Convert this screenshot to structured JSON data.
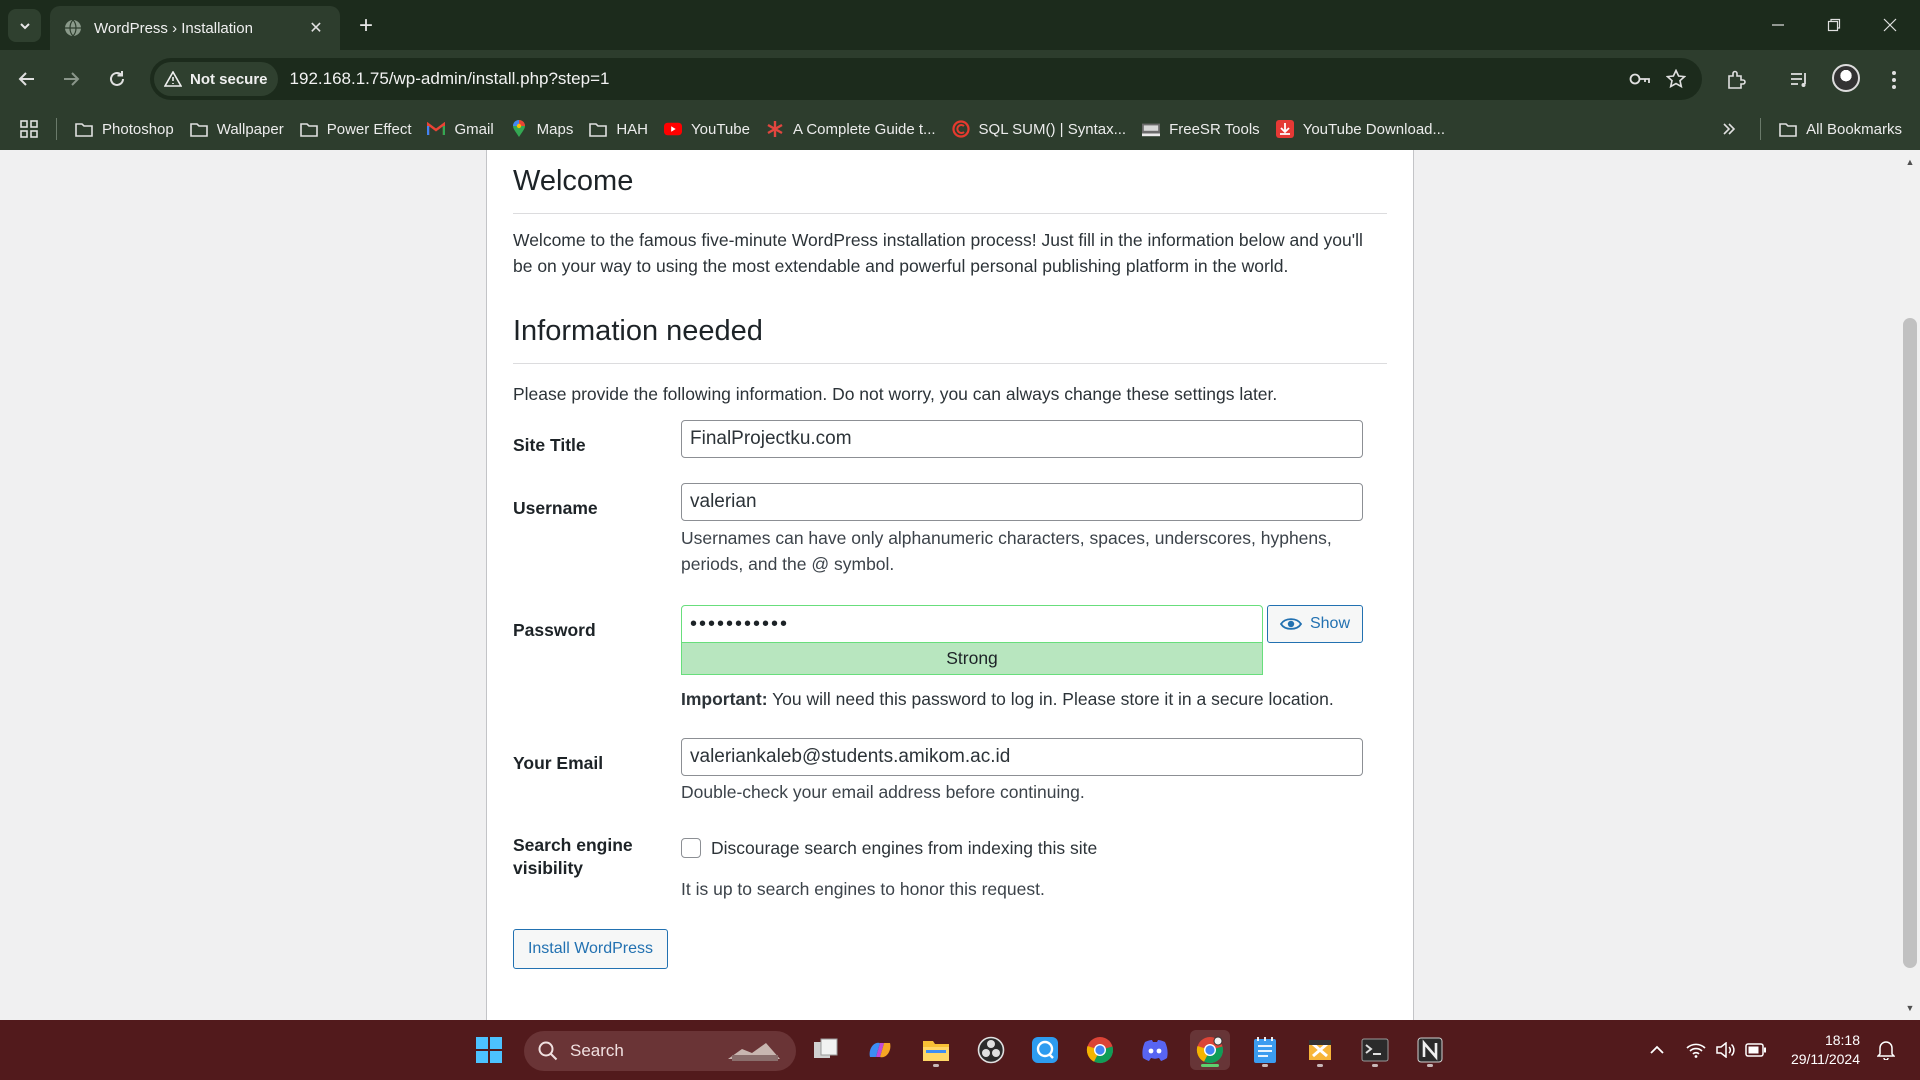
{
  "browser": {
    "tab_title": "WordPress › Installation",
    "security_label": "Not secure",
    "url": "192.168.1.75/wp-admin/install.php?step=1",
    "bookmarks": [
      {
        "label": "Photoshop",
        "icon": "folder-icon"
      },
      {
        "label": "Wallpaper",
        "icon": "folder-icon"
      },
      {
        "label": "Power Effect",
        "icon": "folder-icon"
      },
      {
        "label": "Gmail",
        "icon": "gmail-icon"
      },
      {
        "label": "Maps",
        "icon": "maps-icon"
      },
      {
        "label": "HAH",
        "icon": "folder-icon"
      },
      {
        "label": "YouTube",
        "icon": "youtube-icon"
      },
      {
        "label": "A Complete Guide t...",
        "icon": "asterisk-icon"
      },
      {
        "label": "SQL SUM() | Syntax...",
        "icon": "sql-icon"
      },
      {
        "label": "FreeSR Tools",
        "icon": "freesr-icon"
      },
      {
        "label": "YouTube Download...",
        "icon": "download-icon"
      }
    ],
    "all_bookmarks": "All Bookmarks"
  },
  "page": {
    "welcome_heading": "Welcome",
    "welcome_text_1": "Welcome to the famous five-minute WordPress installation process! Just fill in the information below and you'll",
    "welcome_text_2": "be on your way to using the most extendable and powerful personal publishing platform in the world.",
    "info_heading": "Information needed",
    "info_text": "Please provide the following information. Do not worry, you can always change these settings later.",
    "site_title_label": "Site Title",
    "site_title_value": "FinalProjectku.com",
    "username_label": "Username",
    "username_value": "valerian",
    "username_hint_1": "Usernames can have only alphanumeric characters, spaces, underscores, hyphens,",
    "username_hint_2": "periods, and the @ symbol.",
    "password_label": "Password",
    "password_value": "•••••••••••",
    "password_strength": "Strong",
    "show_label": "Show",
    "important_label": "Important:",
    "important_text": " You will need this password to log in. Please store it in a secure location.",
    "email_label": "Your Email",
    "email_value": "valeriankaleb@students.amikom.ac.id",
    "email_hint": "Double-check your email address before continuing.",
    "search_visibility_label_1": "Search engine",
    "search_visibility_label_2": "visibility",
    "discourage_label": "Discourage search engines from indexing this site",
    "discourage_checked": false,
    "search_hint": "It is up to search engines to honor this request.",
    "install_button": "Install WordPress"
  },
  "taskbar": {
    "search_label": "Search",
    "time": "18:18",
    "date": "29/11/2024"
  },
  "colors": {
    "wp_blue": "#2271b1",
    "strength_bg": "#b8e6bf",
    "taskbar_bg": "#521a1c",
    "chrome_bg": "#2d3d2d"
  }
}
